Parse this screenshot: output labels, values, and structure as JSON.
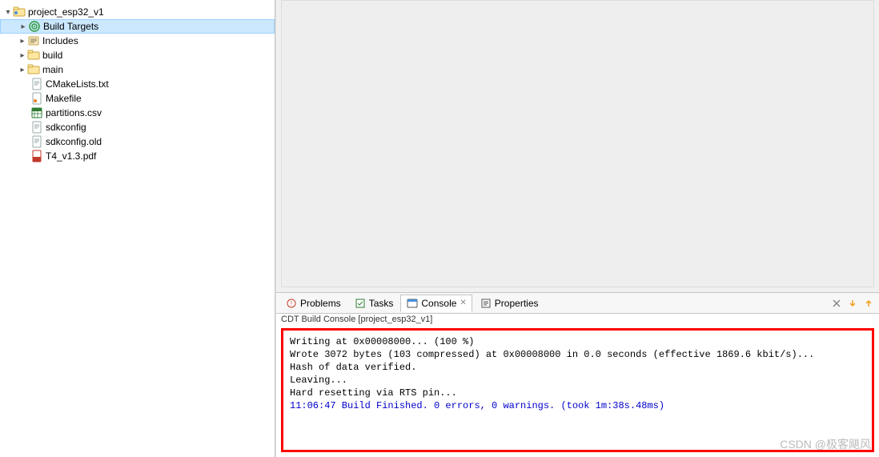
{
  "tree": {
    "root": {
      "label": "project_esp32_v1"
    },
    "items": [
      {
        "label": "Build Targets",
        "selected": true
      },
      {
        "label": "Includes"
      },
      {
        "label": "build"
      },
      {
        "label": "main"
      }
    ],
    "files": [
      {
        "label": "CMakeLists.txt"
      },
      {
        "label": "Makefile"
      },
      {
        "label": "partitions.csv"
      },
      {
        "label": "sdkconfig"
      },
      {
        "label": "sdkconfig.old"
      },
      {
        "label": "T4_v1.3.pdf"
      }
    ]
  },
  "tabs": {
    "problems": "Problems",
    "tasks": "Tasks",
    "console": "Console",
    "properties": "Properties"
  },
  "console": {
    "title": "CDT Build Console [project_esp32_v1]",
    "l1": "Writing at 0x00008000... (100 %)",
    "l2": "Wrote 3072 bytes (103 compressed) at 0x00008000 in 0.0 seconds (effective 1869.6 kbit/s)...",
    "l3": "Hash of data verified.",
    "l4": "",
    "l5": "Leaving...",
    "l6": "Hard resetting via RTS pin...",
    "l7": "",
    "l8": "11:06:47 Build Finished. 0 errors, 0 warnings. (took 1m:38s.48ms)"
  },
  "watermark": "CSDN @极客飓风"
}
